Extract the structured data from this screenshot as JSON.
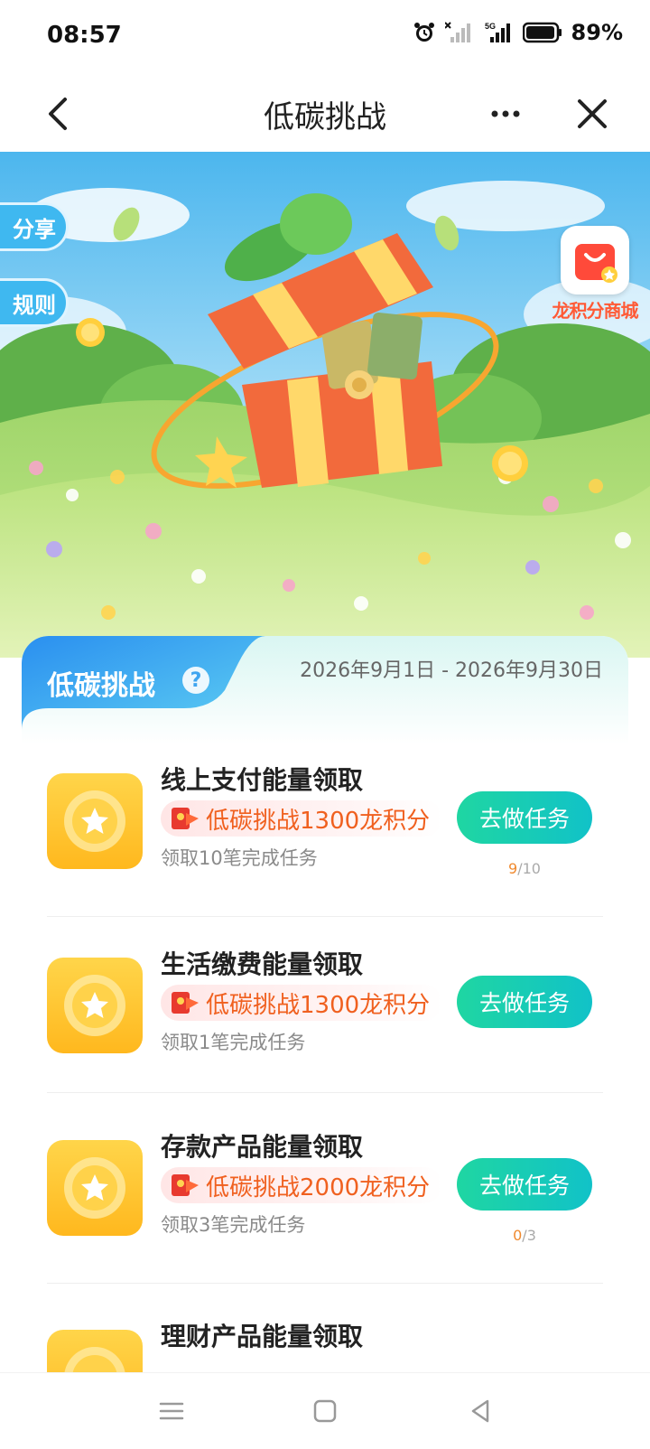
{
  "status_bar": {
    "time": "08:57",
    "battery": "89%",
    "network": "5G"
  },
  "nav": {
    "title": "低碳挑战"
  },
  "hero": {
    "share_label": "分享",
    "rules_label": "规则",
    "mall_label": "龙积分商城"
  },
  "panel": {
    "tab_title": "低碳挑战",
    "date_range": "2026年9月1日 - 2026年9月30日",
    "tasks": [
      {
        "title": "线上支付能量领取",
        "reward": "低碳挑战1300龙积分",
        "desc": "领取10笔完成任务",
        "button": "去做任务",
        "progress_done": "9",
        "progress_total": "/10"
      },
      {
        "title": "生活缴费能量领取",
        "reward": "低碳挑战1300龙积分",
        "desc": "领取1笔完成任务",
        "button": "去做任务"
      },
      {
        "title": "存款产品能量领取",
        "reward": "低碳挑战2000龙积分",
        "desc": "领取3笔完成任务",
        "button": "去做任务",
        "progress_done": "0",
        "progress_total": "/3"
      },
      {
        "title": "理财产品能量领取"
      }
    ]
  },
  "colors": {
    "accent_green": "#1fd6a2",
    "reward_orange": "#f0601f",
    "tab_blue": "#3fa3f0"
  }
}
